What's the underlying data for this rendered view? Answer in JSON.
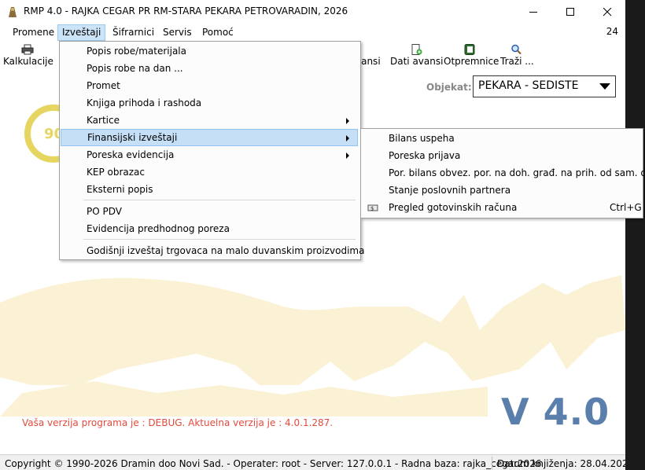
{
  "window": {
    "title": "RMP 4.0 - RAJKA CEGAR PR RM-STARA PEKARA PETROVARADIN, 2026",
    "controls": [
      "minimize",
      "maximize",
      "close"
    ]
  },
  "menubar": {
    "items": [
      {
        "label": "Promene"
      },
      {
        "label": "Izveštaji"
      },
      {
        "label": "Šifrarnici"
      },
      {
        "label": "Servis"
      },
      {
        "label": "Pomoć"
      }
    ],
    "right_number": "24"
  },
  "toolbar": {
    "buttons": [
      {
        "label": "Kalkulacije",
        "icon": "printer-icon"
      },
      {
        "label": "vansi",
        "icon": "none"
      },
      {
        "label": "Dati avansi",
        "icon": "document-add-icon"
      },
      {
        "label": "Otpremnice",
        "icon": "notebook-icon"
      },
      {
        "label": "Traži ...",
        "icon": "magnifier-icon"
      }
    ]
  },
  "filter": {
    "label": "Objekat:",
    "selected": "PEKARA - SEDISTE"
  },
  "izvestaji_menu": {
    "items": [
      {
        "label": "Popis robe/materijala",
        "submenu": false
      },
      {
        "label": "Popis robe na dan ...",
        "submenu": false
      },
      {
        "label": "Promet",
        "submenu": false
      },
      {
        "label": "Knjiga prihoda i rashoda",
        "submenu": false
      },
      {
        "label": "Kartice",
        "submenu": true
      },
      {
        "label": "Finansijski izveštaji",
        "submenu": true
      },
      {
        "label": "Poreska evidencija",
        "submenu": true
      },
      {
        "label": "KEP obrazac",
        "submenu": false
      },
      {
        "label": "Eksterni popis",
        "submenu": false
      },
      {
        "label": "PO PDV",
        "submenu": false
      },
      {
        "label": "Evidencija predhodnog poreza",
        "submenu": false
      },
      {
        "label": "Godišnji izveštaj trgovaca na malo duvanskim proizvodima",
        "submenu": false
      }
    ],
    "highlighted": "Finansijski izveštaji"
  },
  "finansijski_submenu": {
    "items": [
      {
        "label": "Bilans uspeha",
        "shortcut": ""
      },
      {
        "label": "Poreska prijava",
        "shortcut": ""
      },
      {
        "label": "Por. bilans obvez. por. na doh. građ. na prih. od sam. delat.",
        "shortcut": ""
      },
      {
        "label": "Stanje poslovnih partnera",
        "shortcut": ""
      },
      {
        "label": "Pregled gotovinskih računa",
        "shortcut": "Ctrl+G",
        "icon": "cash-icon"
      }
    ]
  },
  "main": {
    "debug_message": "Vaša verzija programa je : DEBUG. Aktuelna verzija je : 4.0.1.287.",
    "version_badge": "V 4.0",
    "logo_fragment": "90"
  },
  "statusbar": {
    "left": "Copyright © 1990-2026 Dramin doo Novi Sad. - Operater: root - Server: 127.0.0.1 - Radna baza: rajka_cegar2026",
    "right": "Datum knjiženja: 28.04.2026"
  },
  "colors": {
    "accent_highlight": "#c5dff6",
    "debug_text": "#e24b3b",
    "version_text": "#5a7fad",
    "watermark": "#fbf2d6"
  }
}
